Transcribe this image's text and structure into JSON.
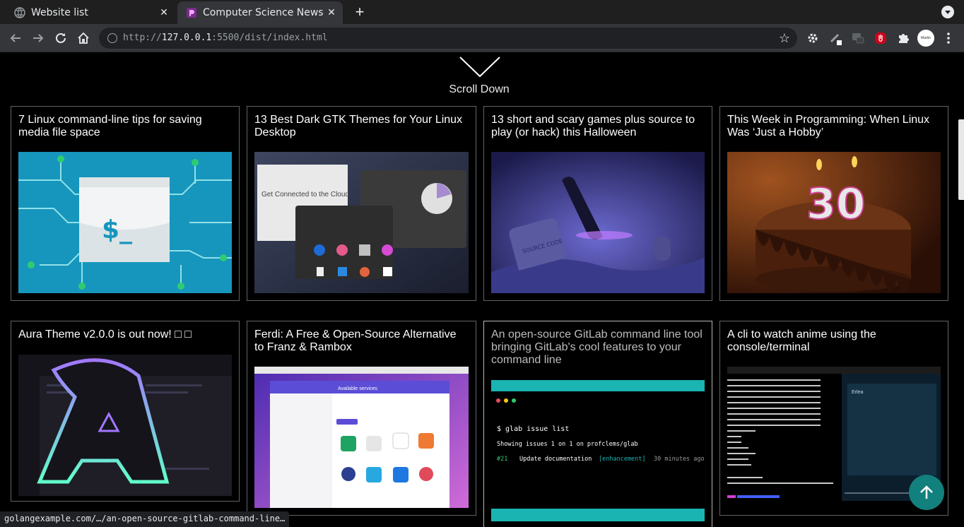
{
  "tabs": [
    {
      "title": "Website list",
      "active": false
    },
    {
      "title": "Computer Science News",
      "active": true
    }
  ],
  "address": {
    "scheme": "http://",
    "host": "127.0.0.1",
    "rest": ":5500/dist/index.html"
  },
  "profile_label": "Martin",
  "scroll_prompt": "Scroll Down",
  "cards": [
    {
      "title": "7 Linux command-line tips for saving media file space",
      "image": "terminal-circuit-illustration"
    },
    {
      "title": "13 Best Dark GTK Themes for Your Linux Desktop",
      "image": "dark-desktop-screenshot",
      "image_text": "Get Connected to the Cloud."
    },
    {
      "title": "13 short and scary games plus source to play (or hack) this Halloween",
      "image": "spooky-graveyard-illustration",
      "image_text": "SOURCE CODE"
    },
    {
      "title": "This Week in Programming: When Linux Was ‘Just a Hobby’",
      "image": "birthday-cake-photo",
      "image_text": "30"
    },
    {
      "title": "Aura Theme v2.0.0 is out now! □ □",
      "image": "aura-theme-logo"
    },
    {
      "title": "Ferdi: A Free & Open-Source Alternative to Franz & Rambox",
      "image": "ferdi-app-screenshot",
      "image_text": "Available services"
    },
    {
      "title": "An open-source GitLab command line tool bringing GitLab's cool features to your command line",
      "image": "glab-terminal",
      "terminal": {
        "command": "$ glab issue list",
        "summary": "Showing issues 1 on 1 on profclems/glab",
        "issue_id": "#21",
        "issue_title": "Update documentation",
        "issue_label": "[enhancement]",
        "issue_time": "30 minutes ago"
      }
    },
    {
      "title": "A cli to watch anime using the console/terminal",
      "image": "anime-cli-screenshot",
      "image_text": "Erlea"
    }
  ],
  "status_url": "golangexample.com/…/an-open-source-gitlab-command-line…",
  "colors": {
    "accent": "#12807d",
    "tab_bar": "#1f1f1f",
    "toolbar": "#35363a",
    "page_bg": "#000000"
  }
}
